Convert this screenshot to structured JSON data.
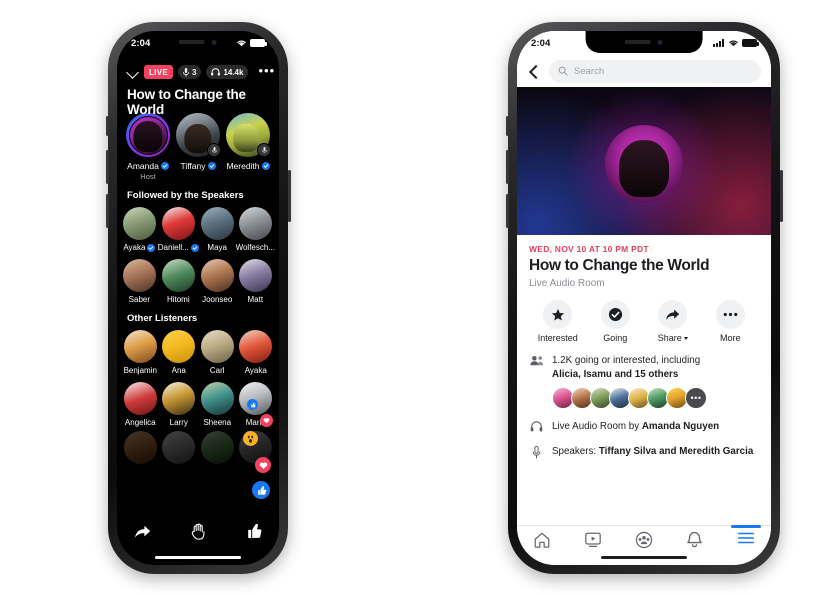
{
  "left_phone": {
    "status_bar": {
      "time": "2:04",
      "signal_icon": "cellular-bars-icon",
      "wifi_icon": "wifi-icon",
      "battery_icon": "battery-icon"
    },
    "top_bar": {
      "minimize_icon": "chevron-down-icon",
      "live_badge": "LIVE",
      "speaker_count": "3",
      "mic_icon": "microphone-icon",
      "listener_count": "14.4k",
      "headphones_icon": "headphones-icon",
      "more_label": "•••",
      "close_icon": "close-icon"
    },
    "room_title": "How to Change the World",
    "speakers": [
      {
        "name": "Amanda",
        "role": "Host",
        "verified": true,
        "speaking": true,
        "muted": false
      },
      {
        "name": "Tiffany",
        "role": "",
        "verified": true,
        "speaking": false,
        "muted": true
      },
      {
        "name": "Meredith",
        "role": "",
        "verified": true,
        "speaking": false,
        "muted": true
      }
    ],
    "followed_section": {
      "label": "Followed by the Speakers",
      "people": [
        {
          "name": "Ayaka",
          "verified": true
        },
        {
          "name": "Daniell...",
          "verified": true
        },
        {
          "name": "Maya",
          "verified": false
        },
        {
          "name": "Wolfesch...",
          "verified": false
        },
        {
          "name": "Saber",
          "verified": false
        },
        {
          "name": "Hitomi",
          "verified": false
        },
        {
          "name": "Joonseo",
          "verified": false
        },
        {
          "name": "Matt",
          "verified": false
        }
      ]
    },
    "listeners_section": {
      "label": "Other Listeners",
      "people": [
        {
          "name": "Benjamin"
        },
        {
          "name": "Ana"
        },
        {
          "name": "Carl"
        },
        {
          "name": "Ayaka"
        },
        {
          "name": "Angelica"
        },
        {
          "name": "Larry"
        },
        {
          "name": "Sheena"
        },
        {
          "name": "Maria"
        }
      ]
    },
    "reactions": [
      "like-reaction",
      "heart-reaction",
      "wow-reaction",
      "heart-reaction",
      "thumbs-up-reaction"
    ],
    "action_bar": [
      {
        "icon": "share-arrow-icon",
        "name": "share-action"
      },
      {
        "icon": "raise-hand-icon",
        "name": "raise-hand-action"
      },
      {
        "icon": "thumbs-up-icon",
        "name": "thumbs-up-action"
      }
    ]
  },
  "right_phone": {
    "status_bar": {
      "time": "2:04",
      "signal_icon": "cellular-bars-icon",
      "wifi_icon": "wifi-icon",
      "battery_icon": "battery-icon"
    },
    "search": {
      "back_icon": "back-chevron-icon",
      "search_icon": "search-icon",
      "placeholder": "Search"
    },
    "event": {
      "date": "WED, NOV 10 AT 10 PM PDT",
      "title": "How to Change the World",
      "subtitle": "Live Audio Room",
      "actions": [
        {
          "label": "Interested",
          "icon": "star-icon",
          "has_caret": false
        },
        {
          "label": "Going",
          "icon": "check-circle-icon",
          "has_caret": false
        },
        {
          "label": "Share",
          "icon": "share-arrow-icon",
          "has_caret": true
        },
        {
          "label": "More",
          "icon": "ellipsis-icon",
          "has_caret": false
        }
      ],
      "attendance": {
        "icon": "friends-icon",
        "line1": "1.2K going or interested, including",
        "line2": "Alicia, Isamu and 15 others",
        "facepile_count": 7,
        "facepile_more": "•••"
      },
      "host_row": {
        "icon": "headphones-icon",
        "prefix": "Live Audio Room by ",
        "name": "Amanda Nguyen"
      },
      "speakers_row": {
        "icon": "microphone-icon",
        "prefix": "Speakers: ",
        "name": "Tiffany Silva and Meredith Garcia"
      }
    },
    "tabbar": [
      {
        "name": "home-tab",
        "icon": "home-icon",
        "active": false
      },
      {
        "name": "watch-tab",
        "icon": "video-play-icon",
        "active": false
      },
      {
        "name": "groups-tab",
        "icon": "groups-icon",
        "active": false
      },
      {
        "name": "notifications-tab",
        "icon": "bell-icon",
        "active": false
      },
      {
        "name": "menu-tab",
        "icon": "hamburger-menu-icon",
        "active": true
      }
    ]
  },
  "colors": {
    "live_red": "#f3425f",
    "event_date_red": "#e4405f",
    "facebook_blue": "#1877f2",
    "dark_bg": "#000000",
    "light_bg": "#ffffff"
  }
}
